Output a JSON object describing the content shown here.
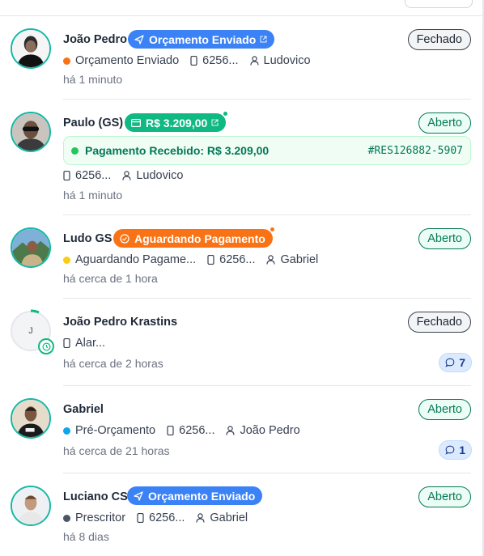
{
  "conversations": [
    {
      "name": "João Pedro",
      "tag": {
        "label": "Orçamento Enviado",
        "color": "#3b82f6",
        "icon": "send-icon"
      },
      "status": "Fechado",
      "stage": {
        "label": "Orçamento Enviado",
        "color": "#f97316"
      },
      "phone": "6256...",
      "agent": "Ludovico",
      "time": "há 1 minuto"
    },
    {
      "name": "Paulo (GS)",
      "tag": {
        "label": "R$ 3.209,00",
        "color": "#10b981",
        "icon": "credit-card-icon"
      },
      "status": "Aberto",
      "payment": {
        "label": "Pagamento Recebido: R$ 3.209,00",
        "reference": "#RES126882-5907"
      },
      "phone": "6256...",
      "agent": "Ludovico",
      "time": "há 1 minuto"
    },
    {
      "name": "Ludo GS",
      "tag": {
        "label": "Aguardando Pagamento",
        "color": "#f97316",
        "icon": "check-circle-icon"
      },
      "status": "Aberto",
      "stage": {
        "label": "Aguardando Pagame...",
        "color": "#facc15"
      },
      "phone": "6256...",
      "agent": "Gabriel",
      "time": "há cerca de 1 hora"
    },
    {
      "name": "João Pedro Krastins",
      "initial": "J",
      "status": "Fechado",
      "phone": "Alar...",
      "time": "há cerca de 2 horas",
      "messages": "7"
    },
    {
      "name": "Gabriel",
      "status": "Aberto",
      "stage": {
        "label": "Pré-Orçamento",
        "color": "#0ea5e9"
      },
      "phone": "6256...",
      "agent": "João Pedro",
      "time": "há cerca de 21 horas",
      "messages": "1"
    },
    {
      "name": "Luciano CS",
      "tag": {
        "label": "Orçamento Enviado",
        "color": "#3b82f6",
        "icon": "send-icon"
      },
      "status": "Aberto",
      "stage": {
        "label": "Prescritor",
        "color": "#4b5563"
      },
      "phone": "6256...",
      "agent": "Gabriel",
      "time": "há 8 dias"
    }
  ]
}
